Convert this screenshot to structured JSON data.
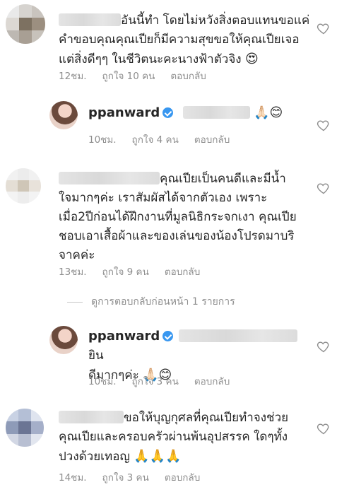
{
  "comments": [
    {
      "text": "อันนี้ทำ โดยไม่หวังสิ่งตอบแทนขอแค่ คำขอบคุณคุณเปียก็มีความสุขขอให้คุณเปียเจอ แต่สิ่งดีๆๆ ในชีวิตนะคะนางฟ้าตัวจิง 😍",
      "line1": "อันนี้ทำ โดยไม่หวังสิ่งตอบแทนขอแค่",
      "line2": "คำขอบคุณคุณเปียก็มีความสุขขอให้คุณเปียเจอ",
      "line3": "แต่สิ่งดีๆๆ ในชีวิตนะคะนางฟ้าตัวจิง",
      "emoji": "😍",
      "time": "12ชม.",
      "likes": "ถูกใจ 10 คน",
      "reply": "ตอบกลับ"
    },
    {
      "username": "ppanward",
      "line1_emoji": "🙏🏻😊",
      "time": "10ชม.",
      "likes": "ถูกใจ 4 คน",
      "reply": "ตอบกลับ"
    },
    {
      "line1": "คุณเปียเป็นคนดีและมีน้ำ",
      "line2": "ใจมากๆค่ะ เราสัมผัสได้จากตัวเอง เพราะ",
      "line3": "เมื่อ2ปีก่อนได้ฝึกงานที่มูลนิธิกระจกเงา คุณเปีย",
      "line4": "ชอบเอาเสื้อผ้าและของเล่นของน้องโปรดมาบริ",
      "line5": "จาคค่ะ",
      "time": "13ชม.",
      "likes": "ถูกใจ 9 คน",
      "reply": "ตอบกลับ"
    },
    {
      "username": "ppanward",
      "line1_tail": "ยิน",
      "line2": "ดีมากๆค่ะ",
      "line2_emoji": "🙏🏻😊",
      "time": "10ชม.",
      "likes": "ถูกใจ 3 คน",
      "reply": "ตอบกลับ"
    },
    {
      "line1": "ขอให้บุญกุศลที่คุณเปียทำจงช่วย",
      "line2": "คุณเปียและครอบครัวผ่านพ้นอุปสรรค ใดๆทั้ง",
      "line3": "ปวงด้วยเทอญ",
      "line3_emoji": "🙏🙏🙏",
      "time": "14ชม.",
      "likes": "ถูกใจ 3 คน",
      "reply": "ตอบกลับ"
    }
  ],
  "view_replies": "ดูการตอบกลับก่อนหน้า 1 รายการ",
  "colors": {
    "text": "#262626",
    "meta": "#8e8e8e",
    "verified": "#3897f0"
  }
}
